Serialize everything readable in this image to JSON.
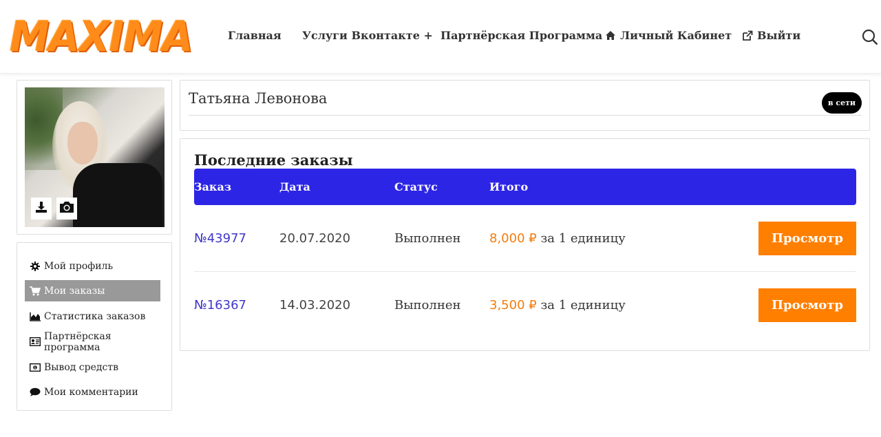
{
  "header": {
    "logo": "MAXIMA",
    "nav": {
      "home": "Главная",
      "vk_services": "Услуги Вконтакте +",
      "partner": "Партнёрская Программа",
      "cabinet": "Личный Кабинет",
      "logout": "Выйти"
    },
    "icons": {
      "cabinet": "home-icon",
      "logout": "external-link-icon",
      "search": "search-icon"
    }
  },
  "sidebar": {
    "avatar_buttons": [
      "download-icon",
      "camera-icon"
    ],
    "menu": [
      {
        "label": "Мой профиль",
        "icon": "gear-icon"
      },
      {
        "label": "Мои заказы",
        "icon": "cart-icon",
        "active": true
      },
      {
        "label": "Статистика заказов",
        "icon": "area-chart-icon"
      },
      {
        "label": "Партнёрская программа",
        "icon": "id-card-icon"
      },
      {
        "label": "Вывод средств",
        "icon": "money-icon"
      },
      {
        "label": "Мои комментарии",
        "icon": "comment-icon"
      }
    ]
  },
  "profile": {
    "name": "Татьяна Левонова",
    "status_badge": "в сети"
  },
  "orders": {
    "title": "Последние заказы",
    "columns": [
      "Заказ",
      "Дата",
      "Статус",
      "Итого"
    ],
    "rows": [
      {
        "number": "№43977",
        "date": "20.07.2020",
        "status": "Выполнен",
        "total": "8,000 ₽",
        "per": "за 1 единицу",
        "action": "Просмотр"
      },
      {
        "number": "№16367",
        "date": "14.03.2020",
        "status": "Выполнен",
        "total": "3,500 ₽",
        "per": "за 1 единицу",
        "action": "Просмотр"
      }
    ]
  },
  "colors": {
    "accent_orange": "#ff7f00",
    "table_header": "#2d25e6",
    "link": "#3f37c9",
    "menu_active": "#999999"
  }
}
